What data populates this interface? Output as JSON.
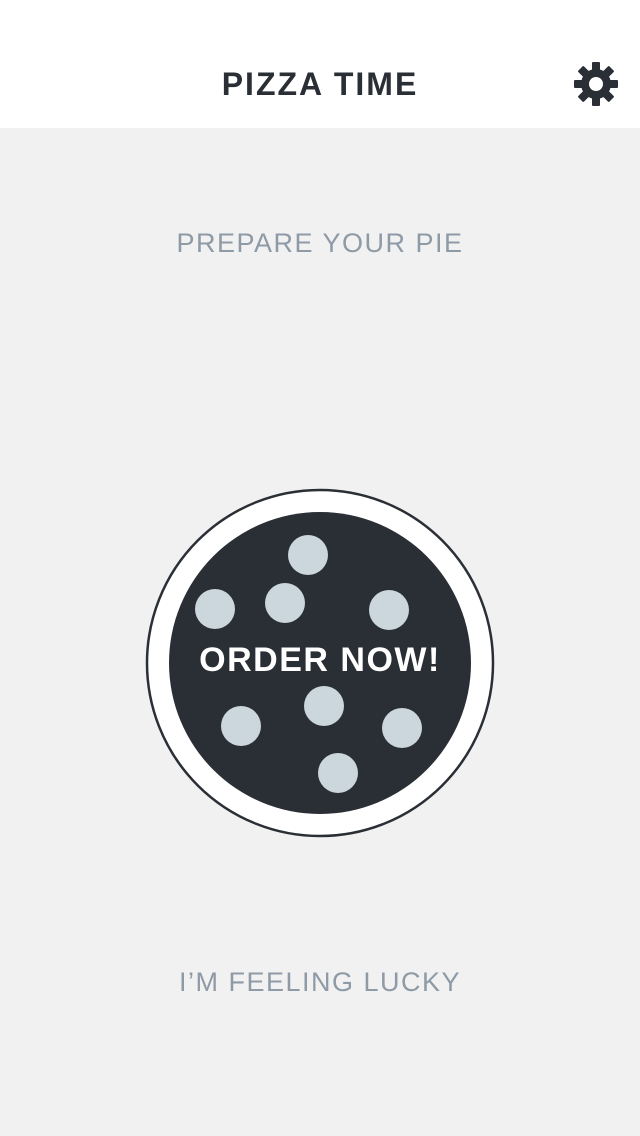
{
  "header": {
    "title": "PIZZA TIME",
    "settings_icon": "gear-icon"
  },
  "main": {
    "prepare_label": "PREPARE YOUR PIE",
    "order_button_label": "ORDER NOW!",
    "lucky_label": "I’M FEELING LUCKY"
  },
  "colors": {
    "background": "#f1f1f1",
    "header_background": "#ffffff",
    "pizza_dark": "#2a2e35",
    "topping": "#ccd6dd",
    "muted_text": "#8e9aa5"
  }
}
